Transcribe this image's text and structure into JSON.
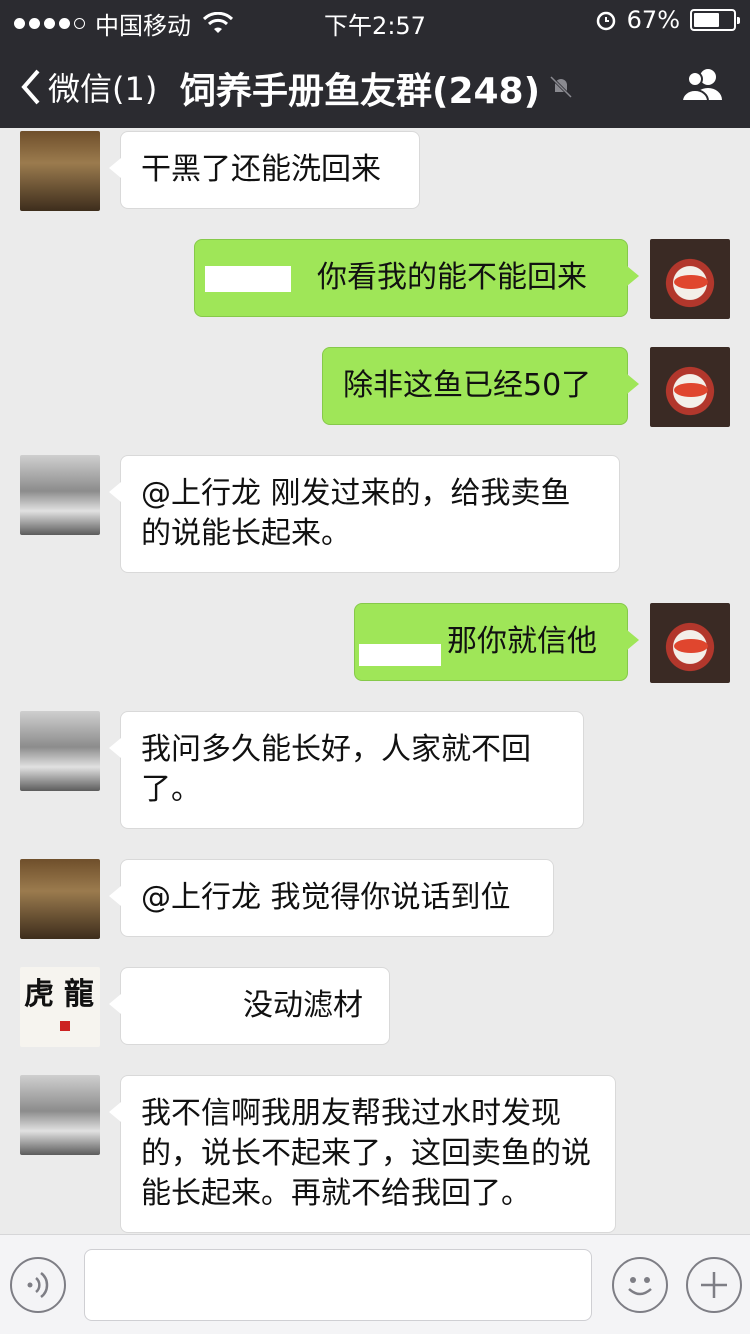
{
  "status_bar": {
    "carrier": "中国移动",
    "time": "下午2:57",
    "battery_percent": "67%",
    "battery_level": 0.67
  },
  "nav": {
    "back_label": "微信(1)",
    "title": "饲养手册鱼友群(248)"
  },
  "messages": [
    {
      "side": "in",
      "avatar": "street",
      "text": "干黑了还能洗回来"
    },
    {
      "side": "out",
      "avatar": "fish",
      "text": "你看我的能不能回来"
    },
    {
      "side": "out",
      "avatar": "fish",
      "text": "除非这鱼已经50了"
    },
    {
      "side": "in",
      "avatar": "beach",
      "text": "@上行龙 刚发过来的，给我卖鱼的说能长起来。"
    },
    {
      "side": "out",
      "avatar": "fish",
      "text": "那你就信他"
    },
    {
      "side": "in",
      "avatar": "beach",
      "text": "我问多久能长好，人家就不回了。"
    },
    {
      "side": "in",
      "avatar": "street",
      "text": "@上行龙 我觉得你说话到位"
    },
    {
      "side": "in",
      "avatar": "callig",
      "text": "没动滤材"
    },
    {
      "side": "in",
      "avatar": "beach",
      "text": "我不信啊我朋友帮我过水时发现的，说长不起来了，这回卖鱼的说能长起来。再就不给我回了。"
    }
  ],
  "input": {
    "placeholder": ""
  },
  "colors": {
    "nav_bg": "#2b2b30",
    "chat_bg": "#ebebeb",
    "bubble_out": "#9fe658",
    "bubble_in": "#ffffff"
  }
}
